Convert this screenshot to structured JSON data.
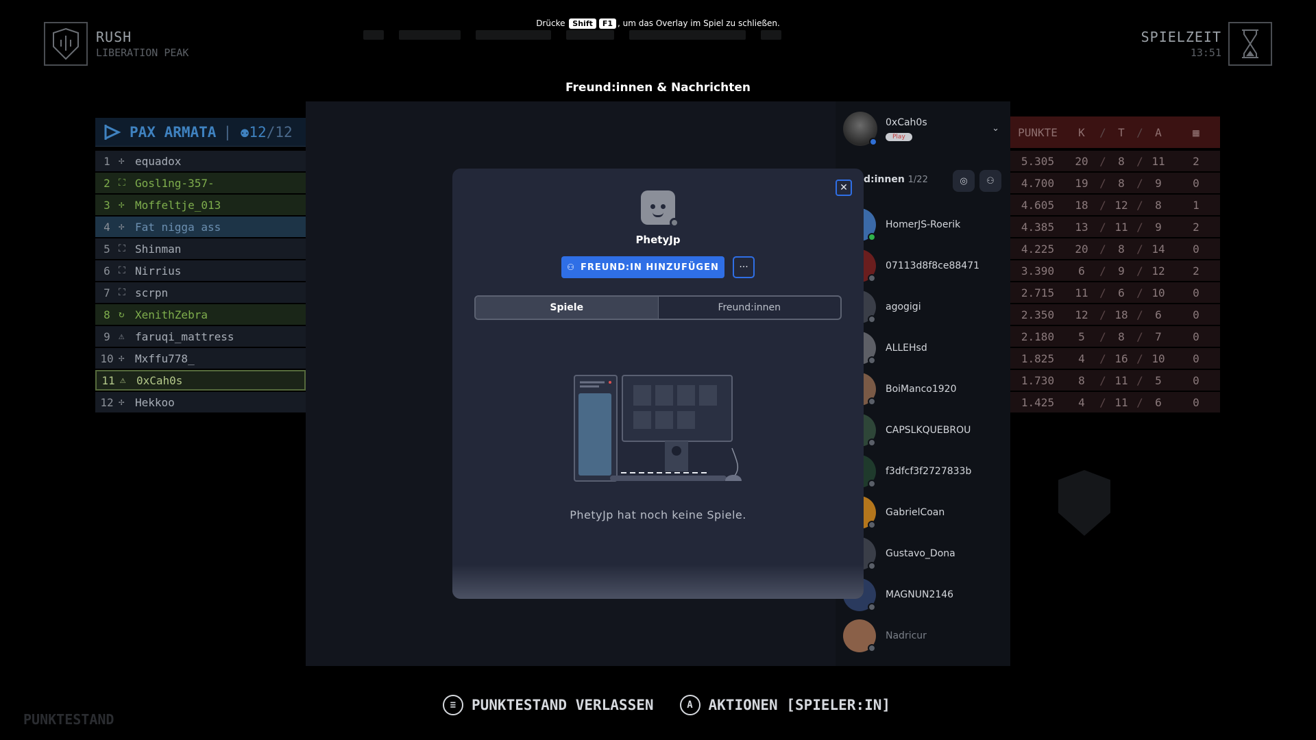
{
  "hud": {
    "mode_title": "RUSH",
    "map_name": "LIBERATION PEAK",
    "time_label": "SPIELZEIT",
    "time_value": "13:51",
    "hint_prefix": "Drücke",
    "hint_key1": "Shift",
    "hint_key2": "F1",
    "hint_suffix": ", um das Overlay im Spiel zu schließen."
  },
  "team": {
    "name": "PAX ARMATA",
    "count_current": "12",
    "count_total": "12",
    "accent": "#3f82c0"
  },
  "players": [
    {
      "rank": "1",
      "name": "equadox",
      "icon": "crosshair-icon",
      "style": "normal"
    },
    {
      "rank": "2",
      "name": "Gosl1ng-357-",
      "icon": "bracket-icon",
      "style": "green"
    },
    {
      "rank": "3",
      "name": "Moffeltje_013",
      "icon": "crosshair-icon",
      "style": "green"
    },
    {
      "rank": "4",
      "name": "Fat nigga ass",
      "icon": "crosshair-icon",
      "style": "sel"
    },
    {
      "rank": "5",
      "name": "Shinman",
      "icon": "bracket-icon",
      "style": "normal"
    },
    {
      "rank": "6",
      "name": "Nirrius",
      "icon": "bracket-icon",
      "style": "normal"
    },
    {
      "rank": "7",
      "name": "scrpn",
      "icon": "bracket-icon",
      "style": "normal"
    },
    {
      "rank": "8",
      "name": "XenithZebra",
      "icon": "cycle-icon",
      "style": "green"
    },
    {
      "rank": "9",
      "name": "faruqi_mattress",
      "icon": "triangle-icon",
      "style": "normal"
    },
    {
      "rank": "10",
      "name": "Mxffu778_",
      "icon": "crosshair-icon",
      "style": "normal"
    },
    {
      "rank": "11",
      "name": "0xCah0s",
      "icon": "triangle-icon",
      "style": "me"
    },
    {
      "rank": "12",
      "name": "Hekkoo",
      "icon": "crosshair-icon",
      "style": "normal"
    }
  ],
  "stats_header": {
    "punkte": "PUNKTE",
    "k": "K",
    "t": "T",
    "a": "A",
    "sep": "/"
  },
  "stats": [
    {
      "p": "5.305",
      "k": "20",
      "t": "8",
      "a": "11",
      "x": "2"
    },
    {
      "p": "4.700",
      "k": "19",
      "t": "8",
      "a": "9",
      "x": "0"
    },
    {
      "p": "4.605",
      "k": "18",
      "t": "12",
      "a": "8",
      "x": "1"
    },
    {
      "p": "4.385",
      "k": "13",
      "t": "11",
      "a": "9",
      "x": "2"
    },
    {
      "p": "4.225",
      "k": "20",
      "t": "8",
      "a": "14",
      "x": "0"
    },
    {
      "p": "3.390",
      "k": "6",
      "t": "9",
      "a": "12",
      "x": "2"
    },
    {
      "p": "2.715",
      "k": "11",
      "t": "6",
      "a": "10",
      "x": "0"
    },
    {
      "p": "2.350",
      "k": "12",
      "t": "18",
      "a": "6",
      "x": "0"
    },
    {
      "p": "2.180",
      "k": "5",
      "t": "8",
      "a": "7",
      "x": "0"
    },
    {
      "p": "1.825",
      "k": "4",
      "t": "16",
      "a": "10",
      "x": "0"
    },
    {
      "p": "1.730",
      "k": "8",
      "t": "11",
      "a": "5",
      "x": "0"
    },
    {
      "p": "1.425",
      "k": "4",
      "t": "11",
      "a": "6",
      "x": "0"
    }
  ],
  "overlay": {
    "title": "Freund:innen & Nachrichten",
    "me_name": "0xCah0s",
    "me_badge": "Play",
    "friends_label": "nd:innen",
    "friends_count": "1/22"
  },
  "friends": [
    {
      "name": "HomerJS-Roerik",
      "online": true,
      "color": "#3b6aa8"
    },
    {
      "name": "07113d8f8ce88471",
      "online": false,
      "color": "#6a1e1e"
    },
    {
      "name": "agogigi",
      "online": false,
      "color": "#3a3e48"
    },
    {
      "name": "ALLEHsd",
      "online": false,
      "color": "#5d5f66"
    },
    {
      "name": "BoiManco1920",
      "online": false,
      "color": "#7a5a46"
    },
    {
      "name": "CAPSLKQUEBROU",
      "online": false,
      "color": "#2e4638"
    },
    {
      "name": "f3dfcf3f2727833b",
      "online": false,
      "color": "#1f3a2c"
    },
    {
      "name": "GabrielCoan",
      "online": false,
      "color": "#b4761c"
    },
    {
      "name": "Gustavo_Dona",
      "online": false,
      "color": "#3a3e48"
    },
    {
      "name": "MAGNUN2146",
      "online": false,
      "color": "#2a3a5e"
    },
    {
      "name": "Nadricur",
      "online": false,
      "color": "#8a6048",
      "dim": true
    }
  ],
  "modal": {
    "player_name": "PhetyJp",
    "add_friend_label": "FREUND:IN HINZUFÜGEN",
    "more_label": "···",
    "close_label": "✕",
    "tab_games": "Spiele",
    "tab_friends": "Freund:innen",
    "empty_text": "PhetyJp hat noch keine Spiele.",
    "accent": "#2f6fe6"
  },
  "bottom": {
    "leave_label": "PUNKTESTAND VERLASSEN",
    "leave_key": "≡",
    "actions_label": "AKTIONEN [SPIELER:IN]",
    "actions_key": "A",
    "ghost_label": "PUNKTESTAND"
  }
}
